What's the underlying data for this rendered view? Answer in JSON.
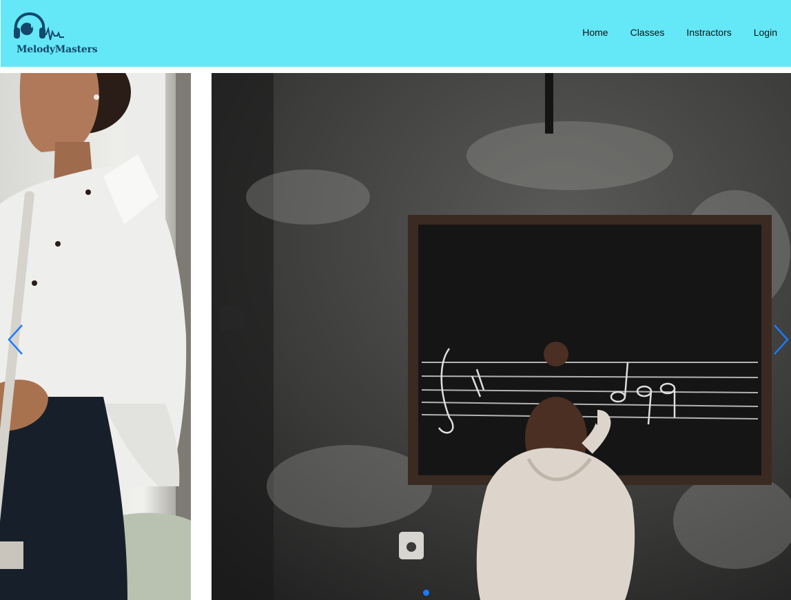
{
  "brand": {
    "name": "MelodyMasters",
    "logo_icon": "headphones-note-logo-icon",
    "nav_background": "#64e8f8",
    "logo_color": "#14476b"
  },
  "nav": {
    "items": [
      {
        "label": "Home",
        "name": "nav-link-home"
      },
      {
        "label": "Classes",
        "name": "nav-link-classes"
      },
      {
        "label": "Instractors",
        "name": "nav-link-instructors"
      },
      {
        "label": "Login",
        "name": "nav-link-login"
      }
    ]
  },
  "slider": {
    "slides": [
      {
        "name": "slide-flute-player",
        "description_icon": "photo-woman-with-flute"
      },
      {
        "name": "slide-chalkboard",
        "description_icon": "photo-girl-writing-music-on-chalkboard"
      }
    ],
    "prev_icon": "chevron-left-icon",
    "next_icon": "chevron-right-icon",
    "active_index": 1,
    "accent": "#1a7bff"
  }
}
